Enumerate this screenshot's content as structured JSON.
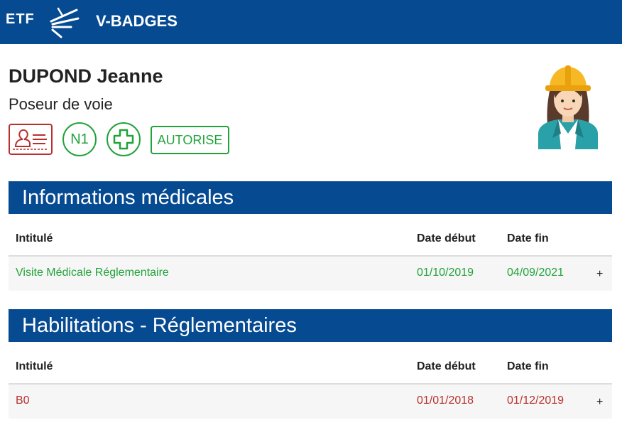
{
  "header": {
    "logo_text": "ETF",
    "app_title": "V-BADGES"
  },
  "person": {
    "name": "DUPOND Jeanne",
    "role": "Poseur de voie"
  },
  "badges": {
    "level": "N1",
    "status": "AUTORISE"
  },
  "colors": {
    "brand_blue": "#064a92",
    "ok_green": "#22a33a",
    "alert_red": "#b8312f"
  },
  "icons": [
    "id-card-icon",
    "first-aid-cross-icon",
    "worker-avatar-icon",
    "etf-logo-icon"
  ],
  "medical": {
    "title": "Informations médicales",
    "columns": [
      "Intitulé",
      "Date début",
      "Date fin"
    ],
    "rows": [
      {
        "label": "Visite Médicale Réglementaire",
        "start": "01/10/2019",
        "end": "04/09/2021",
        "action": "+"
      }
    ]
  },
  "habilitations": {
    "title": "Habilitations - Réglementaires",
    "columns": [
      "Intitulé",
      "Date début",
      "Date fin"
    ],
    "rows": [
      {
        "label": "B0",
        "start": "01/01/2018",
        "end": "01/12/2019",
        "action": "+"
      }
    ]
  }
}
